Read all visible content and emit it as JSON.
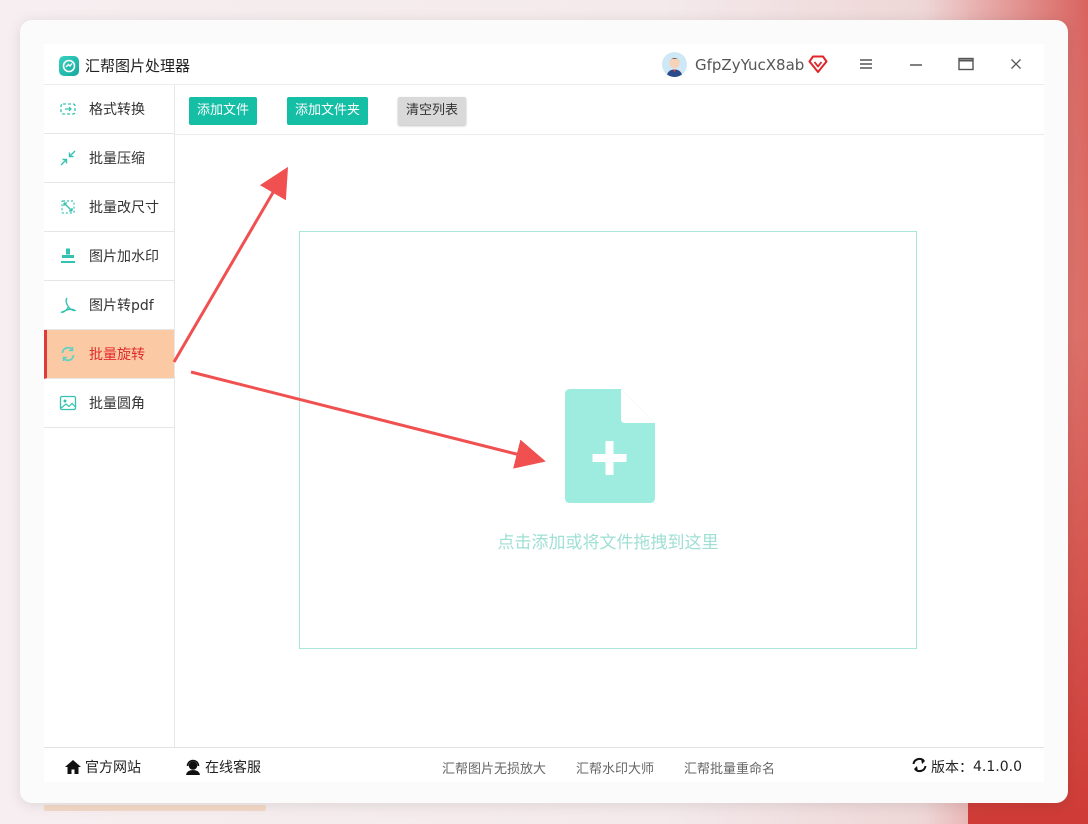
{
  "app": {
    "title": "汇帮图片处理器",
    "username": "GfpZyYucX8ab",
    "icons": {
      "logo": "app-logo-icon",
      "avatar": "user-avatar",
      "vip": "vip-diamond-icon",
      "menu": "hamburger-menu-icon",
      "minimize": "minimize-icon",
      "maximize": "maximize-icon",
      "close": "close-icon"
    },
    "colors": {
      "accent": "#15bfa5",
      "active_bg": "#fbc9a3",
      "active_text": "#e02b2b",
      "drop_border": "#a9e6dc",
      "annotation_arrow": "#f05050"
    }
  },
  "sidebar": {
    "items": [
      {
        "label": "格式转换",
        "icon": "format-convert-icon",
        "active": false
      },
      {
        "label": "批量压缩",
        "icon": "compress-icon",
        "active": false
      },
      {
        "label": "批量改尺寸",
        "icon": "resize-icon",
        "active": false
      },
      {
        "label": "图片加水印",
        "icon": "watermark-icon",
        "active": false
      },
      {
        "label": "图片转pdf",
        "icon": "pdf-icon",
        "active": false
      },
      {
        "label": "批量旋转",
        "icon": "rotate-icon",
        "active": true
      },
      {
        "label": "批量圆角",
        "icon": "rounded-corner-icon",
        "active": false
      }
    ]
  },
  "toolbar": {
    "add_file": "添加文件",
    "add_folder": "添加文件夹",
    "clear_list": "清空列表"
  },
  "dropzone": {
    "icon": "add-file-icon",
    "hint": "点击添加或将文件拖拽到这里"
  },
  "footer": {
    "official_site": "官方网站",
    "online_service": "在线客服",
    "products": [
      "汇帮图片无损放大",
      "汇帮水印大师",
      "汇帮批量重命名"
    ],
    "version_label": "版本：",
    "version_value": "4.1.0.0"
  }
}
